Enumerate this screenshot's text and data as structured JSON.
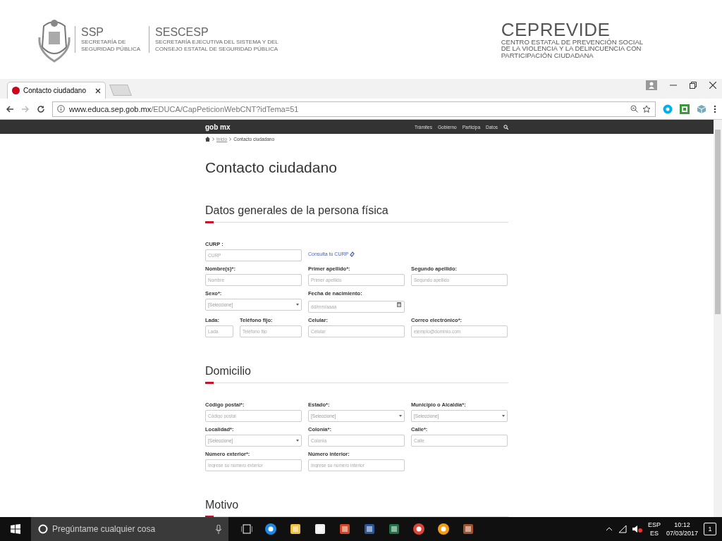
{
  "banner": {
    "left_agency": {
      "acronym": "SSP",
      "lines": [
        "SECRETARÍA DE",
        "SEGURIDAD PÚBLICA"
      ]
    },
    "right_agency": {
      "acronym": "SESCESP",
      "lines": [
        "SECRETARÍA EJECUTIVA DEL SISTEMA Y DEL",
        "CONSEJO ESTATAL DE SEGURIDAD PÚBLICA"
      ]
    },
    "ceprevide": {
      "acronym": "CEPREVIDE",
      "lines": [
        "CENTRO ESTATAL DE PREVENCIÓN SOCIAL",
        "DE LA VIOLENCIA Y LA DELINCUENCIA CON",
        "PARTICIPACIÓN CIUDADANA"
      ]
    }
  },
  "browser": {
    "tabs": [
      {
        "title": "Contacto ciudadano",
        "selected": true
      }
    ],
    "address": {
      "host": "www.educa.sep.gob.mx",
      "path": "/EDUCA/CapPeticionWebCNT?idTema=51"
    }
  },
  "gov_bar": {
    "brand": "gob mx",
    "links": [
      "Trámites",
      "Gobierno",
      "Participa",
      "Datos"
    ]
  },
  "breadcrumb": [
    "Inicio",
    "Contacto ciudadano"
  ],
  "title": "Contacto ciudadano",
  "sections": [
    {
      "title": "Datos generales de la persona física",
      "rows": [
        [
          {
            "kind": "text",
            "label": "CURP :",
            "placeholder": "CURP"
          },
          {
            "kind": "link",
            "text": "Consulta tu CURP"
          }
        ],
        [
          {
            "kind": "text",
            "label": "Nombre(s)*:",
            "placeholder": "Nombre"
          },
          {
            "kind": "text",
            "label": "Primer apellido*:",
            "placeholder": "Primer apellido"
          },
          {
            "kind": "text",
            "label": "Segundo apellido:",
            "placeholder": "Segundo apellido"
          }
        ],
        [
          {
            "kind": "select",
            "label": "Sexo*:",
            "value": "[Seleccione]"
          },
          {
            "kind": "date",
            "label": "Fecha de nacimiento:",
            "placeholder": "dd/mm/aaaa"
          }
        ],
        [
          {
            "kind": "group",
            "fields": [
              {
                "kind": "text",
                "label": "Lada:",
                "placeholder": "Lada"
              },
              {
                "kind": "text",
                "label": "Teléfono fijo:",
                "placeholder": "Teléfono fijo"
              }
            ]
          },
          {
            "kind": "text",
            "label": "Celular:",
            "placeholder": "Celular"
          },
          {
            "kind": "text",
            "label": "Correo electrónico*:",
            "placeholder": "ejemplo@dominio.com"
          }
        ]
      ]
    },
    {
      "title": "Domicilio",
      "rows": [
        [
          {
            "kind": "text",
            "label": "Código postal*:",
            "placeholder": "Código postal"
          },
          {
            "kind": "select",
            "label": "Estado*:",
            "value": "[Seleccione]"
          },
          {
            "kind": "select",
            "label": "Municipio o Alcaldía*:",
            "value": "[Seleccione]"
          }
        ],
        [
          {
            "kind": "select",
            "label": "Localidad*:",
            "value": "[Seleccione]"
          },
          {
            "kind": "text",
            "label": "Colonia*:",
            "placeholder": "Colonia"
          },
          {
            "kind": "text",
            "label": "Calle*:",
            "placeholder": "Calle"
          }
        ],
        [
          {
            "kind": "text",
            "label": "Número exterior*:",
            "placeholder": "Ingrese su número exterior"
          },
          {
            "kind": "text",
            "label": "Número interior:",
            "placeholder": "Ingrese su número interior"
          }
        ]
      ]
    },
    {
      "title": "Motivo"
    }
  ],
  "taskbar": {
    "search_placeholder": "Pregúntame cualquier cosa",
    "language": "ESP",
    "layout": "ES",
    "time": "10:12",
    "date": "07/03/2017",
    "notifications": "1"
  }
}
